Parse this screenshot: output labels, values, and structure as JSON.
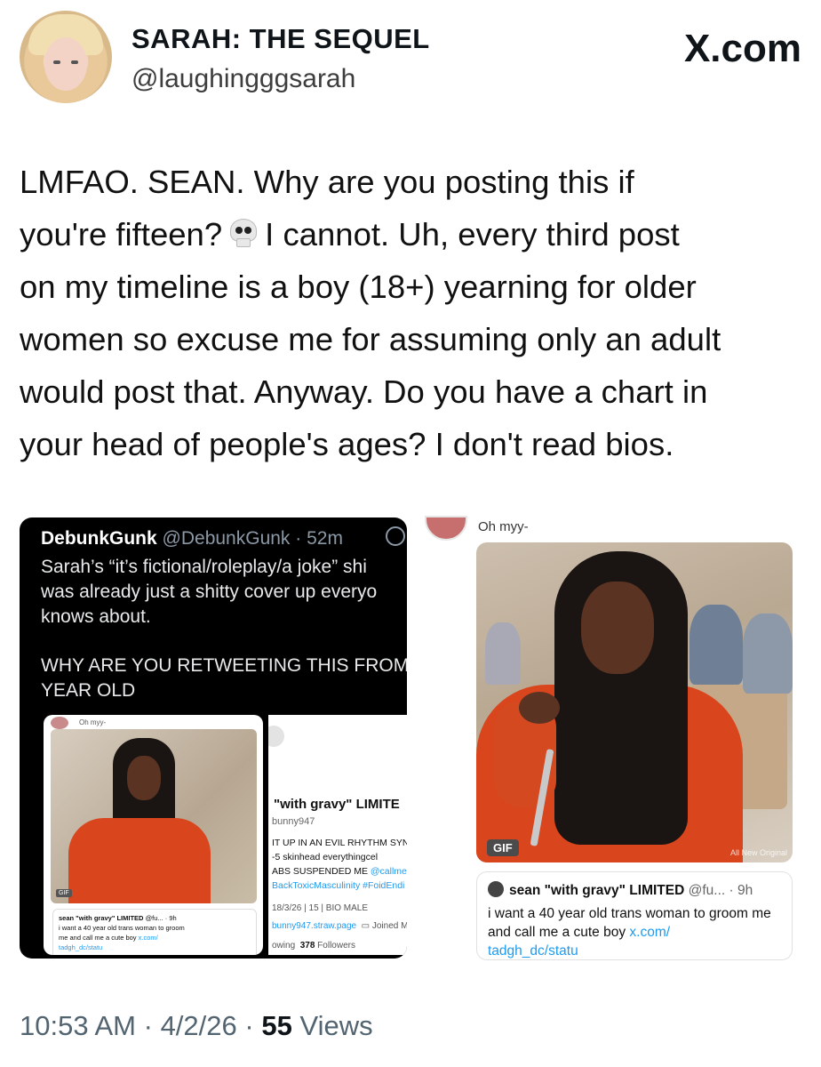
{
  "author": {
    "display_name": "SARAH: THE SEQUEL",
    "handle": "@laughingggsarah",
    "avatar_icon": "profile-avatar"
  },
  "platform": {
    "logo_text": "X.com"
  },
  "tweet": {
    "lines": [
      "LMFAO. SEAN. Why are you posting this if",
      "you're fifteen?",
      "I cannot. Uh, every third post",
      "on my timeline is a boy (18+) yearning for older",
      "women so excuse me for assuming only an adult",
      "would post that. Anyway. Do you have a chart in",
      "your head of people's ages? I don't read bios."
    ],
    "emoji_icon": "skull-emoji"
  },
  "left_screenshot": {
    "name": "DebunkGunk",
    "handle_time": "@DebunkGunk · 52m",
    "body_lines": [
      "Sarah’s “it’s fictional/roleplay/a joke” shi",
      "was already just a shitty cover up everyo",
      "knows about."
    ],
    "caps_lines": [
      "WHY ARE YOU RETWEETING THIS FROM",
      "YEAR OLD"
    ],
    "mini_card": {
      "oh_text": "Oh myy-",
      "gif_label": "GIF",
      "tweet_name": "sean \"with gravy\" LIMITED",
      "tweet_meta": "@fu... · 9h",
      "tweet_line1": "i want a 40 year old trans woman to groom",
      "tweet_line2": "me and call me a cute boy",
      "tweet_link": "x.com/",
      "tweet_line3": "tadgh_dc/statu"
    },
    "profile": {
      "name": "\"with gravy\" LIMITE",
      "handle": "bunny947",
      "bio_line1": "IT UP IN AN EVIL RHYTHM SYN",
      "bio_line2": "-5 skinhead everythingcel",
      "bio_line3": "ABS SUSPENDED ME",
      "bio_line3_link": "@callmesl",
      "bio_line4": "BackToxicMasculinity #FoidEndi",
      "meta": "18/3/26 | 15 | BIO MALE",
      "link": "bunny947.straw.page",
      "joined": "Joined M",
      "following": "owing",
      "followers_count": "378",
      "followers_label": "Followers"
    }
  },
  "right_card": {
    "oh_text": "Oh myy-",
    "gif_label": "GIF",
    "watermark": "All New Original",
    "quote": {
      "name": "sean \"with gravy\" LIMITED",
      "meta": "@fu... · 9h",
      "body": "i want a 40 year old trans woman to groom me and call me a cute boy",
      "link": "x.com/",
      "cut_line": "tadgh_dc/statu"
    }
  },
  "footer": {
    "time": "10:53 AM",
    "sep1": "·",
    "date": "4/2/26",
    "sep2": "·",
    "views_count": "55",
    "views_label": "Views"
  }
}
